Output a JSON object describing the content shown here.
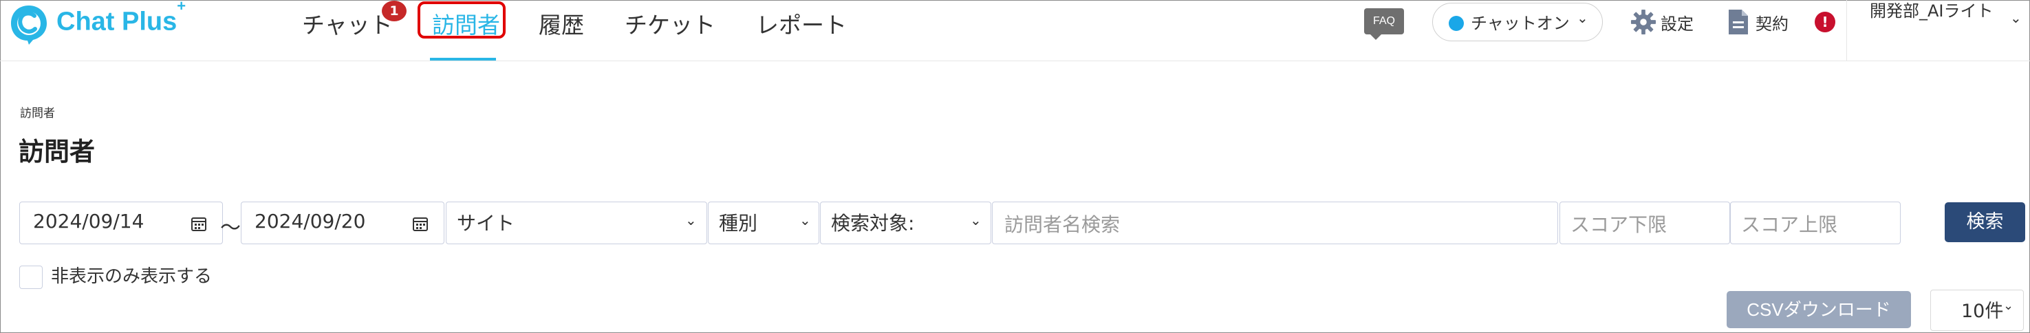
{
  "brand": {
    "name": "Chat Plus",
    "plus": "+",
    "color": "#29b6e6"
  },
  "nav": {
    "items": [
      {
        "label": "チャット",
        "badge": "1"
      },
      {
        "label": "訪問者",
        "active": true
      },
      {
        "label": "履歴"
      },
      {
        "label": "チケット"
      },
      {
        "label": "レポート"
      }
    ],
    "highlight_color": "#e00000"
  },
  "header": {
    "faq_label": "FAQ",
    "status_label": "チャットオン",
    "status_color": "#1aa7e8",
    "settings_label": "設定",
    "contract_label": "契約",
    "alert_symbol": "!",
    "user_label": "開発部_AIライト",
    "icons": [
      "gear-icon",
      "document-icon",
      "alert-icon",
      "chevron-down-icon"
    ]
  },
  "page": {
    "breadcrumb": "訪問者",
    "title": "訪問者"
  },
  "filters": {
    "date_from": "2024/09/14",
    "date_sep": "〜",
    "date_to": "2024/09/20",
    "site": "サイト",
    "type": "種別",
    "search_target": "検索対象:",
    "name_placeholder": "訪問者名検索",
    "score_min_placeholder": "スコア下限",
    "score_max_placeholder": "スコア上限",
    "search_button": "検索",
    "search_button_color": "#2b4a78"
  },
  "options": {
    "hidden_only_label": "非表示のみ表示する",
    "hidden_only_checked": false
  },
  "actions": {
    "csv_label": "CSVダウンロード",
    "per_page": "10件"
  }
}
